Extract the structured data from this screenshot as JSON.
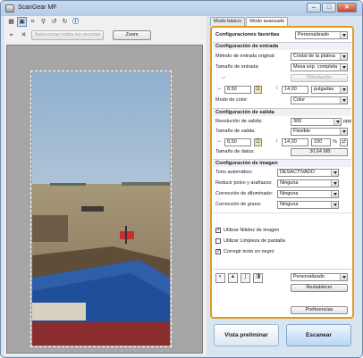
{
  "window": {
    "title": "ScanGear MF",
    "minimize": "–",
    "maximize": "□",
    "close": "✕"
  },
  "toolbar": {
    "icons": [
      "thumbnail-view-icon",
      "whole-image-icon",
      "crop-icon",
      "zoom-icon",
      "rotate-left-icon",
      "rotate-right-icon",
      "info-icon"
    ],
    "select_all_crops_label": "Seleccionar todos los recortes",
    "zoom_label": "Zoom"
  },
  "tabs": {
    "basic": "Modo básico",
    "advanced": "Modo avanzado"
  },
  "favorites": {
    "label": "Configuraciones favoritas",
    "value": "Personalizado"
  },
  "input_settings": {
    "header": "Configuración de entrada",
    "source_label": "Método de entrada original:",
    "source_value": "Cristal de la platina",
    "size_label": "Tamaño de entrada:",
    "size_value": "Mesa exp. completa",
    "orientation_label": "Orientación",
    "width": "8,50",
    "height": "14,00",
    "unit": "pulgadas",
    "color_mode_label": "Modo de color:",
    "color_mode_value": "Color"
  },
  "output_settings": {
    "header": "Configuración de salida",
    "resolution_label": "Resolución de salida:",
    "resolution_value": "300",
    "resolution_unit": "ppp",
    "size_label": "Tamaño de salida:",
    "size_value": "Flexible",
    "width": "8,50",
    "height": "14,00",
    "scale": "100",
    "scale_unit": "%",
    "data_size_label": "Tamaño de datos:",
    "data_size_value": "30,64 MB"
  },
  "image_settings": {
    "header": "Configuración de imagen",
    "rows": [
      {
        "label": "Tono automático:",
        "value": "DESACTIVADO"
      },
      {
        "label": "Reducir polvo y arañazos:",
        "value": "Ninguna"
      },
      {
        "label": "Corrección de difuminado:",
        "value": "Ninguna"
      },
      {
        "label": "Corrección de grano:",
        "value": "Ninguna"
      }
    ],
    "checkboxes": [
      {
        "label": "Utilizar Nitidez de imagen",
        "checked": true
      },
      {
        "label": "Utilizar Limpieza de pantalla",
        "checked": false
      },
      {
        "label": "Corregir texto en negro",
        "checked": true
      }
    ]
  },
  "adjust": {
    "icons": [
      "brightness-contrast-icon",
      "histogram-icon",
      "tone-curve-icon",
      "threshold-icon"
    ],
    "preset_value": "Personalizado",
    "reset_label": "Restablecer"
  },
  "preferences_label": "Preferencias",
  "actions": {
    "preview_label": "Vista preliminar",
    "scan_label": "Escanear"
  },
  "colors": {
    "accent_border": "#e49a1e",
    "window_bg": "#d9e4f1",
    "preview_bg": "#a6a6a6"
  }
}
